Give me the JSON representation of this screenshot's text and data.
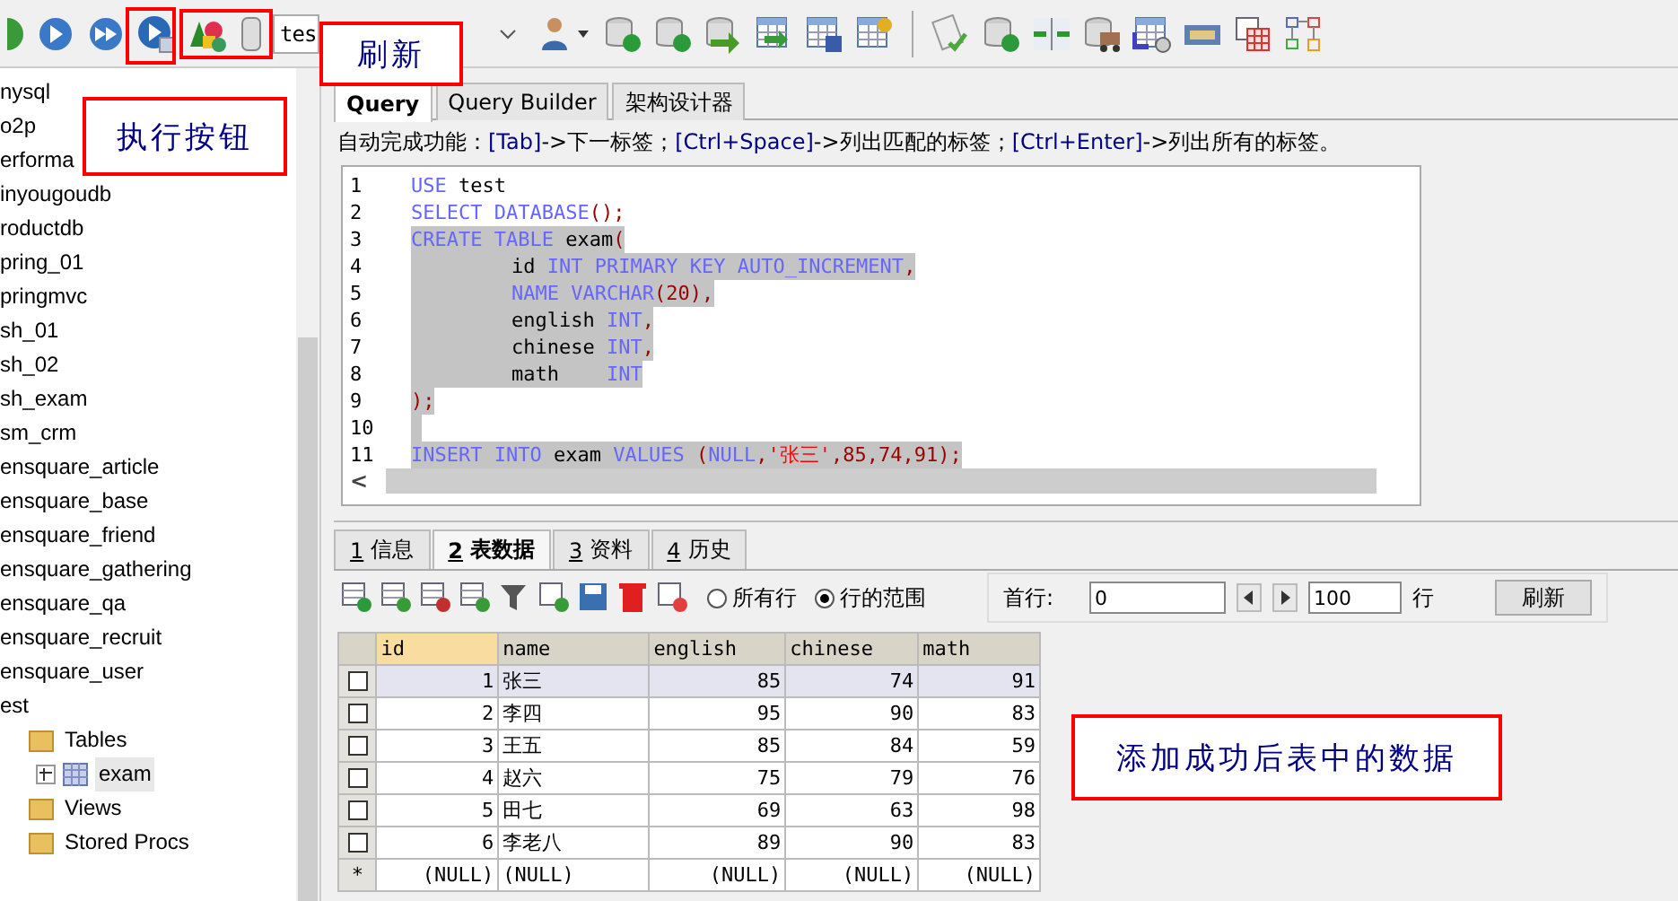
{
  "toolbar": {
    "database_select": {
      "value": "tes"
    }
  },
  "sidebar": {
    "items": [
      {
        "label": "nysql"
      },
      {
        "label": "o2p"
      },
      {
        "label": "erforma"
      },
      {
        "label": "inyougoudb"
      },
      {
        "label": "roductdb"
      },
      {
        "label": "pring_01"
      },
      {
        "label": "pringmvc"
      },
      {
        "label": "sh_01"
      },
      {
        "label": "sh_02"
      },
      {
        "label": "sh_exam"
      },
      {
        "label": "sm_crm"
      },
      {
        "label": "ensquare_article"
      },
      {
        "label": "ensquare_base"
      },
      {
        "label": "ensquare_friend"
      },
      {
        "label": "ensquare_gathering"
      },
      {
        "label": "ensquare_qa"
      },
      {
        "label": "ensquare_recruit"
      },
      {
        "label": "ensquare_user"
      },
      {
        "label": "est",
        "children": [
          {
            "label": "Tables",
            "kind": "folder",
            "children": [
              {
                "label": "exam",
                "kind": "table",
                "selected": true,
                "expanded": false
              }
            ]
          },
          {
            "label": "Views",
            "kind": "folder"
          },
          {
            "label": "Stored Procs",
            "kind": "folder"
          }
        ]
      }
    ]
  },
  "editor_tabs": [
    {
      "label": "Query",
      "selected": true
    },
    {
      "label": "Query Builder",
      "selected": false
    },
    {
      "label": "架构设计器",
      "selected": false
    }
  ],
  "hint": [
    {
      "text": "自动完成功能：",
      "kind": "plain"
    },
    {
      "text": "[Tab]",
      "kind": "key"
    },
    {
      "text": "->下一标签；",
      "kind": "plain"
    },
    {
      "text": "[Ctrl+Space]",
      "kind": "key"
    },
    {
      "text": "->列出匹配的标签；",
      "kind": "plain"
    },
    {
      "text": "[Ctrl+Enter]",
      "kind": "key"
    },
    {
      "text": "->列出所有的标签。",
      "kind": "plain"
    }
  ],
  "editor": {
    "lines": [
      {
        "number": "1",
        "selected": false,
        "indented": false,
        "tokens": [
          {
            "text": "USE",
            "kind": "kw"
          },
          {
            "text": " test",
            "kind": "plain"
          }
        ]
      },
      {
        "number": "2",
        "selected": false,
        "indented": false,
        "tokens": [
          {
            "text": "SELECT DATABASE",
            "kind": "kw"
          },
          {
            "text": "();",
            "kind": "punct"
          }
        ]
      },
      {
        "number": "3",
        "selected": true,
        "indented": false,
        "tokens": [
          {
            "text": "CREATE TABLE",
            "kind": "kw"
          },
          {
            "text": " exam",
            "kind": "plain"
          },
          {
            "text": "(",
            "kind": "punct"
          }
        ]
      },
      {
        "number": "4",
        "selected": true,
        "indented": true,
        "tokens": [
          {
            "text": "id ",
            "kind": "plain"
          },
          {
            "text": "INT PRIMARY KEY AUTO_INCREMENT",
            "kind": "kw"
          },
          {
            "text": ",",
            "kind": "punct"
          }
        ]
      },
      {
        "number": "5",
        "selected": true,
        "indented": true,
        "tokens": [
          {
            "text": "NAME VARCHAR",
            "kind": "kw"
          },
          {
            "text": "(20),",
            "kind": "punct"
          }
        ]
      },
      {
        "number": "6",
        "selected": true,
        "indented": true,
        "tokens": [
          {
            "text": "english ",
            "kind": "plain"
          },
          {
            "text": "INT",
            "kind": "kw"
          },
          {
            "text": ",",
            "kind": "punct"
          }
        ]
      },
      {
        "number": "7",
        "selected": true,
        "indented": true,
        "tokens": [
          {
            "text": "chinese ",
            "kind": "plain"
          },
          {
            "text": "INT",
            "kind": "kw"
          },
          {
            "text": ",",
            "kind": "punct"
          }
        ]
      },
      {
        "number": "8",
        "selected": true,
        "indented": true,
        "tokens": [
          {
            "text": "math    ",
            "kind": "plain"
          },
          {
            "text": "INT",
            "kind": "kw"
          }
        ]
      },
      {
        "number": "9",
        "selected": true,
        "indented": false,
        "tokens": [
          {
            "text": ");",
            "kind": "punct"
          }
        ]
      },
      {
        "number": "10",
        "selected": true,
        "indented": false
      },
      {
        "number": "11",
        "selected": true,
        "indented": false,
        "tokens": [
          {
            "text": "INSERT INTO",
            "kind": "kw"
          },
          {
            "text": " exam ",
            "kind": "plain"
          },
          {
            "text": "VALUES ",
            "kind": "kw"
          },
          {
            "text": "(",
            "kind": "punct"
          },
          {
            "text": "NULL",
            "kind": "kw"
          },
          {
            "text": ",",
            "kind": "punct"
          },
          {
            "text": "'张三'",
            "kind": "str"
          },
          {
            "text": ",85,74,91);",
            "kind": "punct"
          }
        ]
      }
    ],
    "scroll_left": "<"
  },
  "result_tabs": [
    {
      "key": "1",
      "label": "信息",
      "selected": false
    },
    {
      "key": "2",
      "label": "表数据",
      "selected": true
    },
    {
      "key": "3",
      "label": "资料",
      "selected": false
    },
    {
      "key": "4",
      "label": "历史",
      "selected": false
    }
  ],
  "grid_toolbar": {
    "radios": [
      {
        "label": "所有行",
        "selected": false
      },
      {
        "label": "行的范围",
        "selected": true
      }
    ],
    "first_row_label": "首行:",
    "first_row": "0",
    "row_count": "100",
    "rows_label": "行",
    "refresh_button": "刷新"
  },
  "table": {
    "columns": [
      {
        "label": "id",
        "selected": true
      },
      {
        "label": "name",
        "selected": false
      },
      {
        "label": "english",
        "selected": false
      },
      {
        "label": "chinese",
        "selected": false
      },
      {
        "label": "math",
        "selected": false
      }
    ],
    "rows": [
      {
        "selected": true,
        "checked": false,
        "cells": [
          "1",
          "张三",
          "85",
          "74",
          "91"
        ]
      },
      {
        "selected": false,
        "checked": false,
        "cells": [
          "2",
          "李四",
          "95",
          "90",
          "83"
        ]
      },
      {
        "selected": false,
        "checked": false,
        "cells": [
          "3",
          "王五",
          "85",
          "84",
          "59"
        ]
      },
      {
        "selected": false,
        "checked": false,
        "cells": [
          "4",
          "赵六",
          "75",
          "79",
          "76"
        ]
      },
      {
        "selected": false,
        "checked": false,
        "cells": [
          "5",
          "田七",
          "69",
          "63",
          "98"
        ]
      },
      {
        "selected": false,
        "checked": false,
        "cells": [
          "6",
          "李老八",
          "89",
          "90",
          "83"
        ]
      }
    ],
    "new_row": {
      "marker": "*",
      "cells": [
        "(NULL)",
        "(NULL)",
        "(NULL)",
        "(NULL)",
        "(NULL)"
      ]
    }
  },
  "annotations": [
    {
      "kind": "box"
    },
    {
      "kind": "box"
    },
    {
      "kind": "label",
      "text": "刷新"
    },
    {
      "kind": "label",
      "text": "执行按钮"
    },
    {
      "kind": "label",
      "text": "添加成功后表中的数据"
    }
  ]
}
